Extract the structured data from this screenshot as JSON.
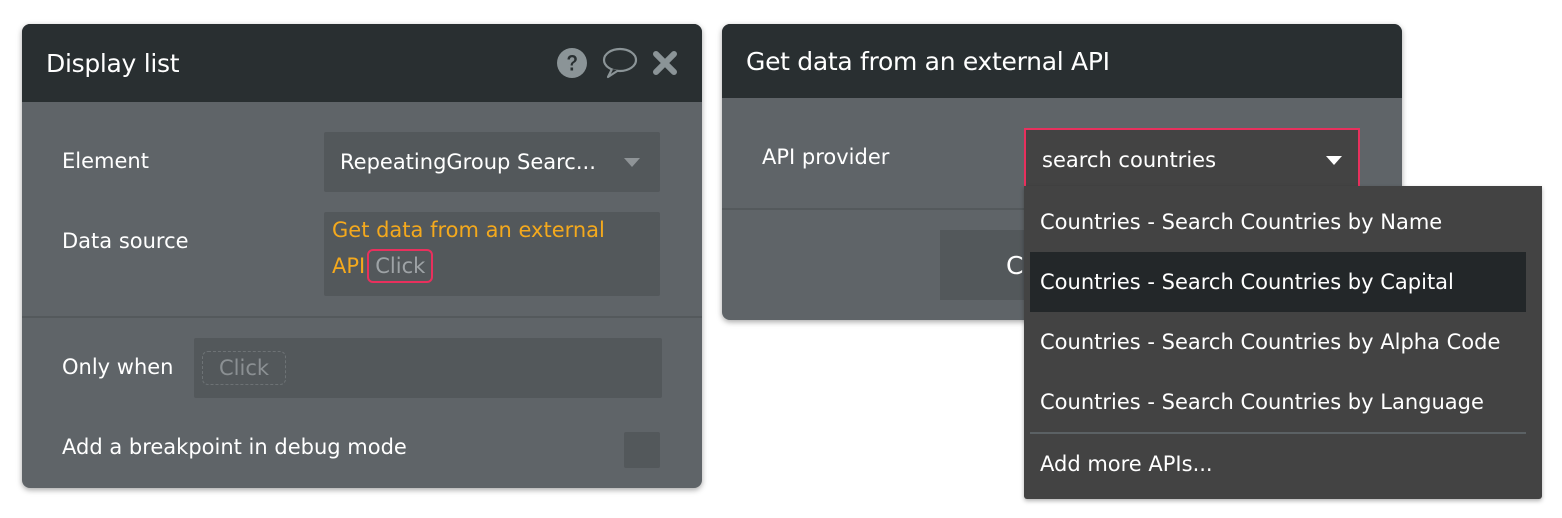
{
  "display_list": {
    "title": "Display list",
    "icons": [
      "help-icon",
      "comment-icon",
      "close-icon"
    ],
    "element": {
      "label": "Element",
      "value": "RepeatingGroup Searc..."
    },
    "data_source": {
      "label": "Data source",
      "value_line1": "Get data from an external",
      "value_line2": "API",
      "click_label": "Click"
    },
    "only_when": {
      "label": "Only when",
      "click_label": "Click"
    },
    "breakpoint": {
      "label": "Add a breakpoint in debug mode",
      "checked": false
    }
  },
  "api_panel": {
    "title": "Get data from an external API",
    "api_provider": {
      "label": "API provider",
      "value": "search countries"
    },
    "button_label_visible": "C"
  },
  "dropdown": {
    "options": [
      {
        "label": "Countries - Search Countries by Name",
        "highlighted": false
      },
      {
        "label": "Countries - Search Countries by Capital",
        "highlighted": true
      },
      {
        "label": "Countries - Search Countries by Alpha Code",
        "highlighted": false
      },
      {
        "label": "Countries - Search Countries by Language",
        "highlighted": false
      }
    ],
    "footer_option": "Add more APIs..."
  },
  "colors": {
    "header_bg": "#292f31",
    "panel_bg": "#5f6468",
    "field_bg": "#53585b",
    "accent_orange": "#f4a91d",
    "accent_red": "#e8305d",
    "dropdown_bg": "#434343",
    "dropdown_highlight": "#232729"
  }
}
